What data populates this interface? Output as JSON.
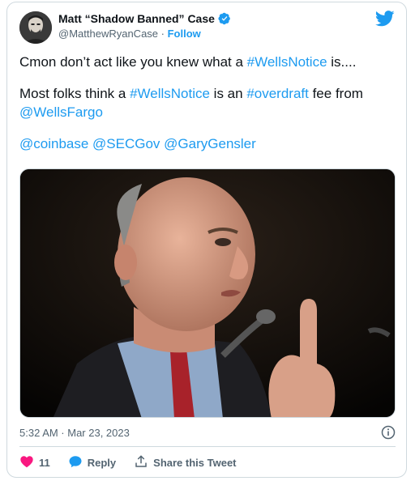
{
  "author": {
    "display_name": "Matt “Shadow Banned” Case",
    "handle": "@MatthewRyanCase",
    "separator": " · ",
    "follow_label": "Follow",
    "verified": true
  },
  "tweet": {
    "line1": {
      "before": "Cmon don’t act like you knew what a ",
      "hashtag": "#WellsNotice",
      "after": " is...."
    },
    "line2": {
      "before": "Most folks think a ",
      "hashtag1": "#WellsNotice",
      "middle": " is an ",
      "hashtag2": "#overdraft",
      "after": " fee from ",
      "mention": "@WellsFargo"
    },
    "line3": {
      "mention1": "@coinbase",
      "mention2": "@SECGov",
      "mention3": "@GaryGensler"
    }
  },
  "meta": {
    "timestamp": "5:32 AM · Mar 23, 2023"
  },
  "actions": {
    "like_count": "11",
    "reply_label": "Reply",
    "share_label": "Share this Tweet"
  },
  "colors": {
    "accent": "#1d9bf0",
    "like": "#f91880",
    "text": "#0f1419",
    "muted": "#536471"
  },
  "icons": [
    "twitter-bird-icon",
    "verified-badge-icon",
    "info-icon",
    "heart-icon",
    "reply-bubble-icon",
    "share-icon"
  ]
}
